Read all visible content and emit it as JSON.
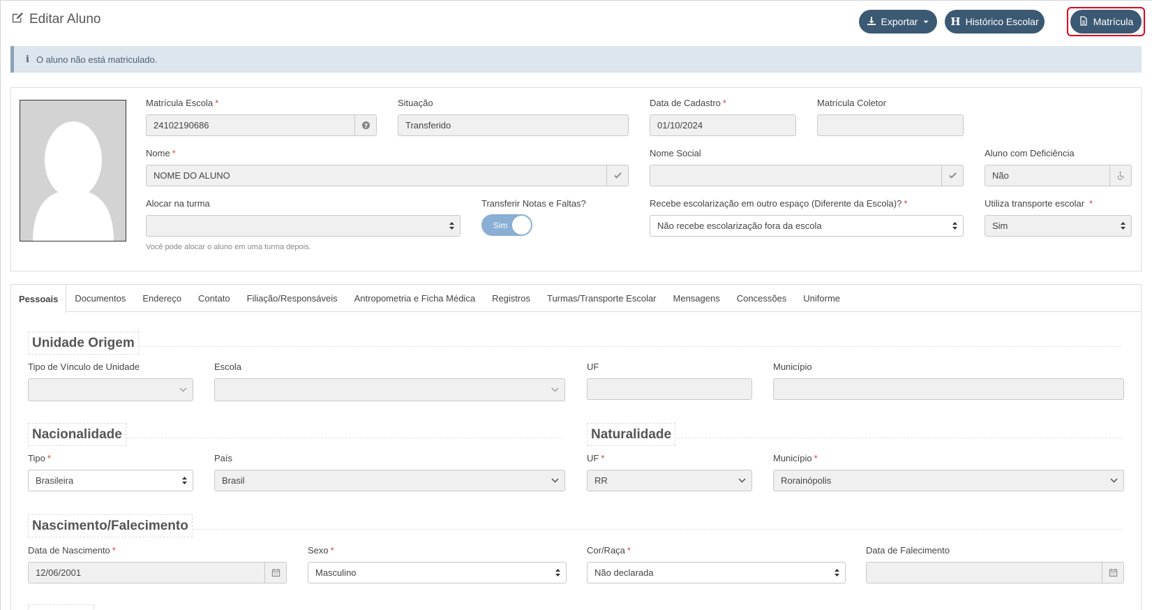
{
  "header": {
    "title": "Editar Aluno",
    "buttons": {
      "exportar": "Exportar",
      "historico": "Histórico Escolar",
      "matricula": "Matrícula"
    }
  },
  "alert": {
    "text": "O aluno não está matriculado."
  },
  "student": {
    "matricula_escola": {
      "label": "Matrícula Escola",
      "value": "24102190686"
    },
    "situacao": {
      "label": "Situação",
      "value": "Transferido"
    },
    "data_cadastro": {
      "label": "Data de Cadastro",
      "value": "01/10/2024"
    },
    "matricula_coletor": {
      "label": "Matrícula Coletor",
      "value": ""
    },
    "nome": {
      "label": "Nome",
      "value": "NOME DO ALUNO"
    },
    "nome_social": {
      "label": "Nome Social",
      "value": ""
    },
    "deficiencia": {
      "label": "Aluno com Deficiência",
      "value": "Não"
    },
    "alocar_turma": {
      "label": "Alocar na turma",
      "value": "",
      "help": "Você pode alocar o aluno em uma turma depois."
    },
    "transferir_notas": {
      "label": "Transferir Notas e Faltas?",
      "value": "Sim"
    },
    "escolarizacao": {
      "label": "Recebe escolarização em outro espaço (Diferente da Escola)?",
      "value": "Não recebe escolarização fora da escola"
    },
    "transporte": {
      "label": "Utiliza transporte escolar",
      "value": "Sim"
    }
  },
  "tabs": [
    {
      "label": "Pessoais",
      "active": true
    },
    {
      "label": "Documentos"
    },
    {
      "label": "Endereço"
    },
    {
      "label": "Contato"
    },
    {
      "label": "Filiação/Responsáveis"
    },
    {
      "label": "Antropometria e Ficha Médica"
    },
    {
      "label": "Registros"
    },
    {
      "label": "Turmas/Transporte Escolar"
    },
    {
      "label": "Mensagens"
    },
    {
      "label": "Concessões"
    },
    {
      "label": "Uniforme"
    }
  ],
  "unidade_origem": {
    "title": "Unidade Origem",
    "tipo_vinculo": {
      "label": "Tipo de Vínculo de Unidade",
      "value": ""
    },
    "escola": {
      "label": "Escola",
      "value": ""
    },
    "uf": {
      "label": "UF",
      "value": ""
    },
    "municipio": {
      "label": "Município",
      "value": ""
    }
  },
  "nacionalidade": {
    "title": "Nacionalidade",
    "tipo": {
      "label": "Tipo",
      "value": "Brasileira"
    },
    "pais": {
      "label": "País",
      "value": "Brasil"
    }
  },
  "naturalidade": {
    "title": "Naturalidade",
    "uf": {
      "label": "UF",
      "value": "RR"
    },
    "municipio": {
      "label": "Município",
      "value": "Rorainópolis"
    }
  },
  "nascimento": {
    "title": "Nascimento/Falecimento",
    "data_nascimento": {
      "label": "Data de Nascimento",
      "value": "12/06/2001"
    },
    "sexo": {
      "label": "Sexo",
      "value": "Masculino"
    },
    "cor_raca": {
      "label": "Cor/Raça",
      "value": "Não declarada"
    },
    "data_falecimento": {
      "label": "Data de Falecimento",
      "value": ""
    }
  },
  "icons": {
    "edit": "edit-icon",
    "download": "download-icon",
    "history": "h-icon",
    "file": "file-icon",
    "info": "info-icon",
    "help": "question-circle-icon",
    "check": "check-icon",
    "wheelchair": "wheelchair-icon",
    "calendar": "calendar-icon",
    "sort": "sort-icon",
    "chevron": "chevron-down-icon"
  },
  "colors": {
    "primary": "#3b5973",
    "alert_bg": "#dde5ee",
    "required": "#d43f3a",
    "highlight": "#e0001b",
    "toggle": "#8aaed4"
  }
}
